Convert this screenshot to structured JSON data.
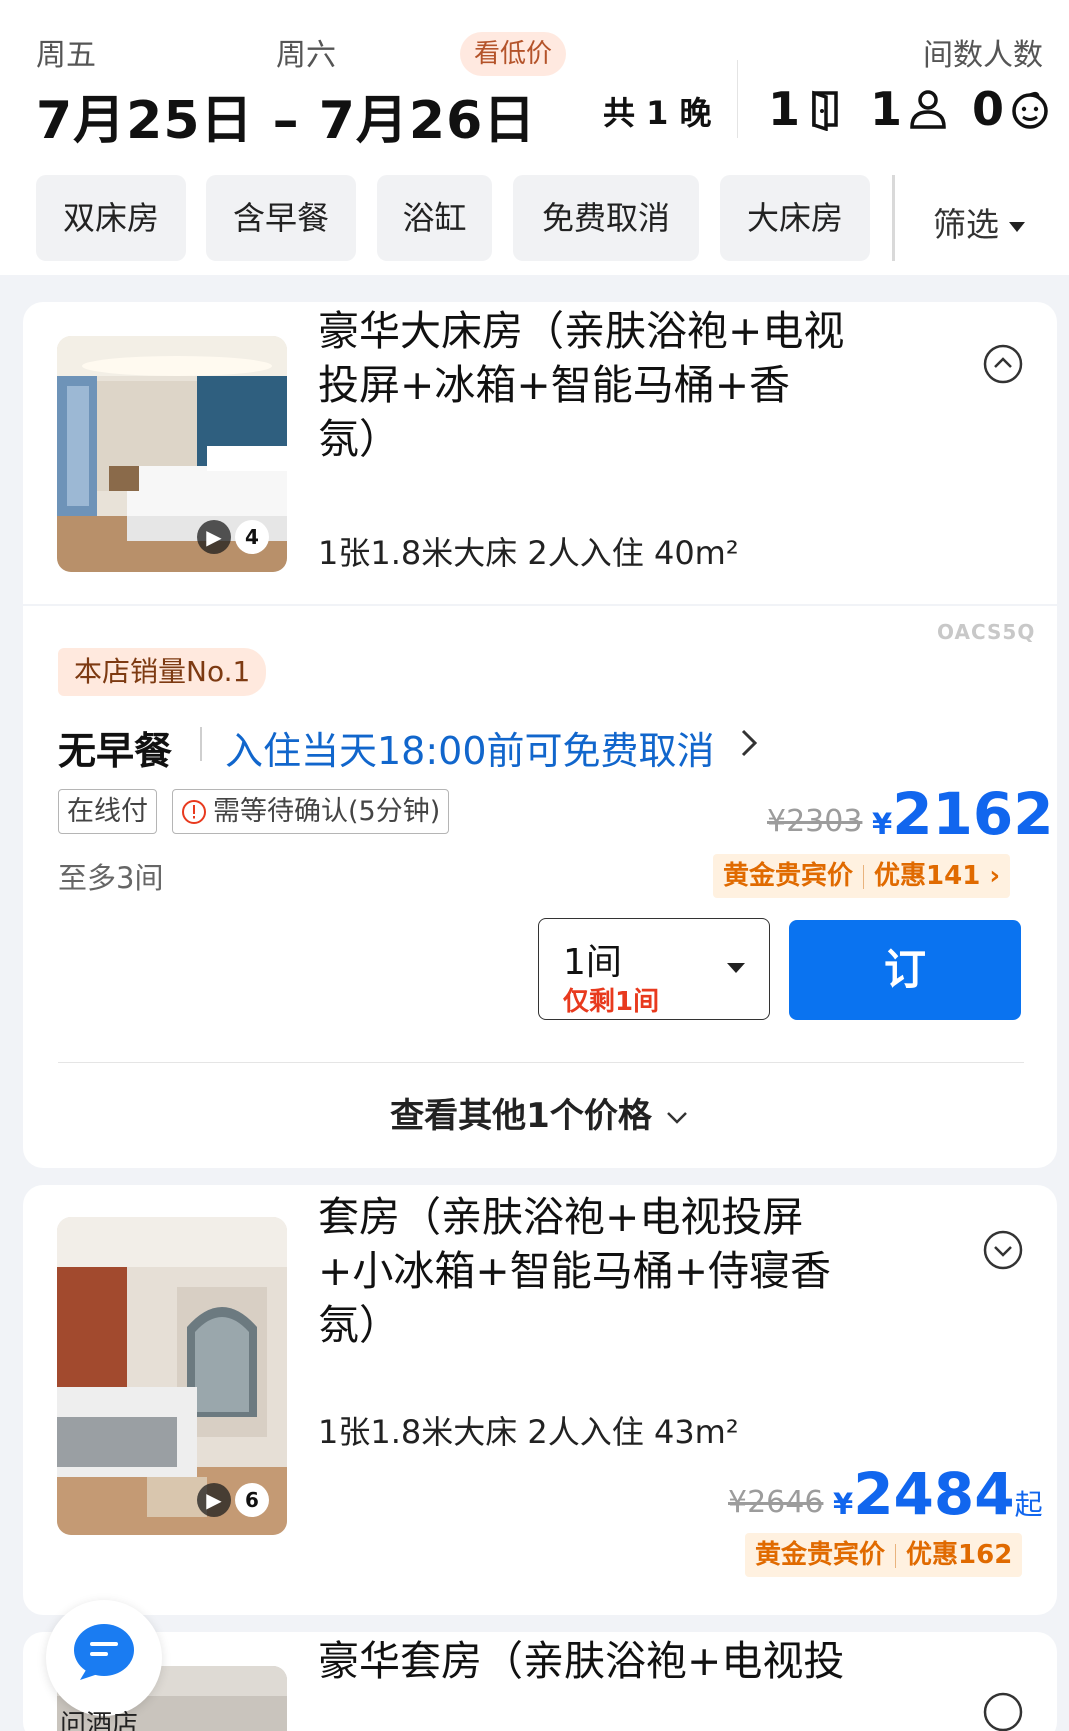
{
  "header": {
    "checkin_day": "周五",
    "checkout_day": "周六",
    "date_range": "7月25日 – 7月26日",
    "low_price_label": "看低价",
    "nights": "共 1 晚",
    "guests_label": "间数人数",
    "rooms": "1",
    "adults": "1",
    "children": "0"
  },
  "filters": {
    "chips": [
      "双床房",
      "含早餐",
      "浴缸",
      "免费取消",
      "大床房"
    ],
    "filter_label": "筛选"
  },
  "rooms": [
    {
      "title": "豪华大床房（亲肤浴袍+电视投屏+冰箱+智能马桶+香氛）",
      "title_lines": [
        "豪华大床房（亲肤浴袍+电视",
        "投屏+冰箱+智能马桶+香",
        "氛）"
      ],
      "specs": "1张1.8米大床  2人入住  40m²",
      "video_count": "4",
      "expanded": true
    },
    {
      "title": "套房（亲肤浴袍+电视投屏+小冰箱+智能马桶+侍寝香氛）",
      "title_lines": [
        "套房（亲肤浴袍+电视投屏",
        "+小冰箱+智能马桶+侍寝香",
        "氛）"
      ],
      "specs": "1张1.8米大床  2人入住  43m²",
      "video_count": "6",
      "old_price": "¥2646",
      "price_currency": "¥",
      "price": "2484",
      "price_suffix": "起",
      "gold_label": "黄金贵宾价",
      "discount": "优惠162",
      "expanded": false
    },
    {
      "title_lines": [
        "豪华套房（亲肤浴袍+电视投"
      ],
      "expanded": false
    }
  ],
  "offer": {
    "watermark": "OACS5Q",
    "badge": "本店销量No.1",
    "meal": "无早餐",
    "cancel_policy": "入住当天18:00前可免费取消",
    "pay_tag": "在线付",
    "confirm_tag": "需等待确认(5分钟)",
    "max_rooms": "至多3间",
    "old_price": "¥2303",
    "price_currency": "¥",
    "price": "2162",
    "gold_label": "黄金贵宾价",
    "discount": "优惠141",
    "quantity": "1间",
    "quantity_note": "仅剩1间",
    "book_label": "订",
    "more_prices": "查看其他1个价格"
  },
  "chat": {
    "label": "问酒店"
  },
  "colors": {
    "accent": "#0a73f0",
    "price": "#1166ee",
    "gold": "#e06a00",
    "urgent": "#e83a1e"
  },
  "icons": [
    "door-icon",
    "adult-icon",
    "child-icon",
    "chevron-up-circle-icon",
    "chevron-down-circle-icon",
    "chevron-right-icon",
    "warning-icon",
    "play-icon",
    "chat-icon"
  ]
}
